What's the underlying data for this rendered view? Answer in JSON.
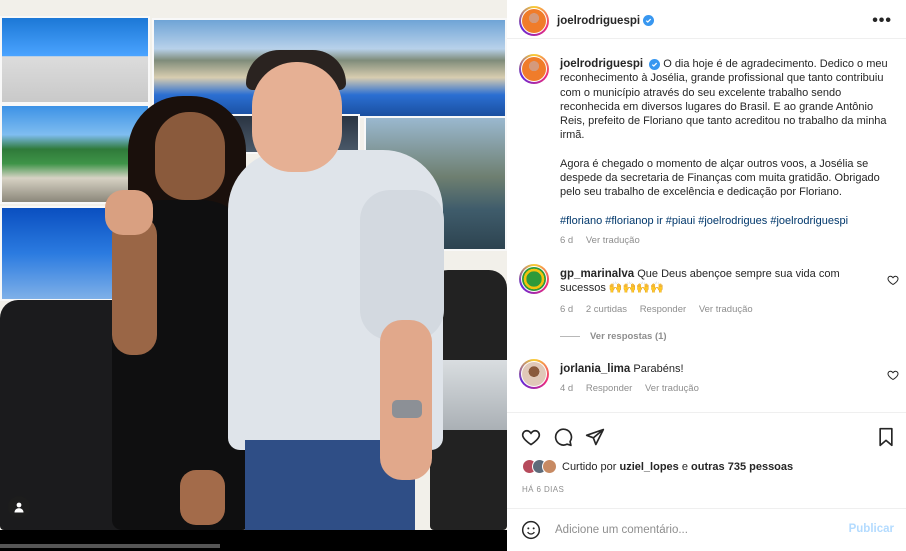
{
  "post": {
    "username": "joelrodriguespi",
    "caption": {
      "username": "joelrodriguespi",
      "paragraph1": "O dia hoje é de agradecimento. Dedico o meu reconhecimento à Josélia, grande profissional que tanto contribuiu com o município através do seu excelente trabalho sendo reconhecida em diversos lugares do Brasil. E ao grande Antônio Reis, prefeito de Floriano que tanto acreditou no trabalho da minha irmã.",
      "paragraph2": "Agora é chegado o momento de alçar outros voos, a Josélia se despede da secretaria de Finanças com muita gratidão. Obrigado pelo seu trabalho de excelência e dedicação por Floriano.",
      "hashtags": "#floriano #florianop ir #piaui #joelrodrigues #joelrodriguespi",
      "time": "6 d",
      "translate": "Ver tradução"
    },
    "comments": [
      {
        "username": "gp_marinalva",
        "text": "Que Deus abençoe sempre sua vida com sucessos 🙌🙌🙌🙌",
        "time": "6 d",
        "likes": "2 curtidas",
        "reply": "Responder",
        "translate": "Ver tradução",
        "replies_label": "Ver respostas (1)"
      },
      {
        "username": "jorlania_lima",
        "text": "Parabéns!",
        "time": "4 d",
        "reply": "Responder",
        "translate": "Ver tradução"
      }
    ],
    "liked_by_prefix": "Curtido por",
    "liked_by_user": "uziel_lopes",
    "liked_by_mid": "e",
    "liked_by_others": "outras 735 pessoas",
    "date": "HÁ 6 DIAS",
    "add_comment_placeholder": "Adicione um comentário...",
    "publish_label": "Publicar"
  },
  "colors": {
    "verified": "#3897f0",
    "link": "#00376b",
    "muted": "#8e8e8e",
    "publish_disabled": "#b3dbff"
  }
}
